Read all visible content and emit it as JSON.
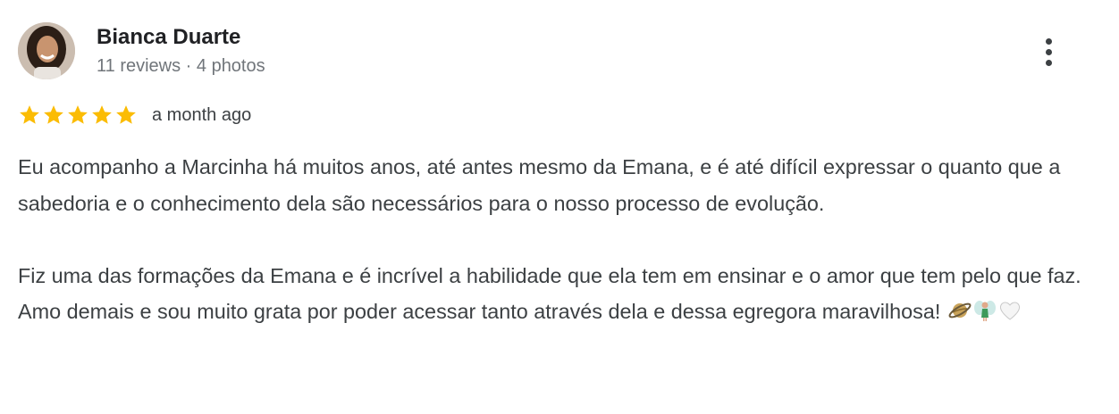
{
  "review": {
    "author": {
      "name": "Bianca Duarte",
      "meta": "11 reviews · 4 photos",
      "avatar_icon": "avatar-photo"
    },
    "more_icon": "more-vert-icon",
    "rating": 5,
    "rating_max": 5,
    "star_color": "#fbbc04",
    "date": "a month ago",
    "paragraphs": [
      "Eu acompanho a Marcinha há muitos anos, até antes mesmo da Emana, e é até difícil expressar o quanto que a sabedoria e o conhecimento dela são necessários para o nosso processo de evolução.",
      "Fiz uma das formações da Emana e é incrível a habilidade que ela tem em ensinar e o amor que tem pelo que faz. Amo demais e sou muito grata por poder acessar tanto através dela e dessa egregora maravilhosa!"
    ],
    "emojis": [
      "ringed-planet-emoji",
      "fairy-emoji",
      "white-heart-emoji"
    ]
  }
}
